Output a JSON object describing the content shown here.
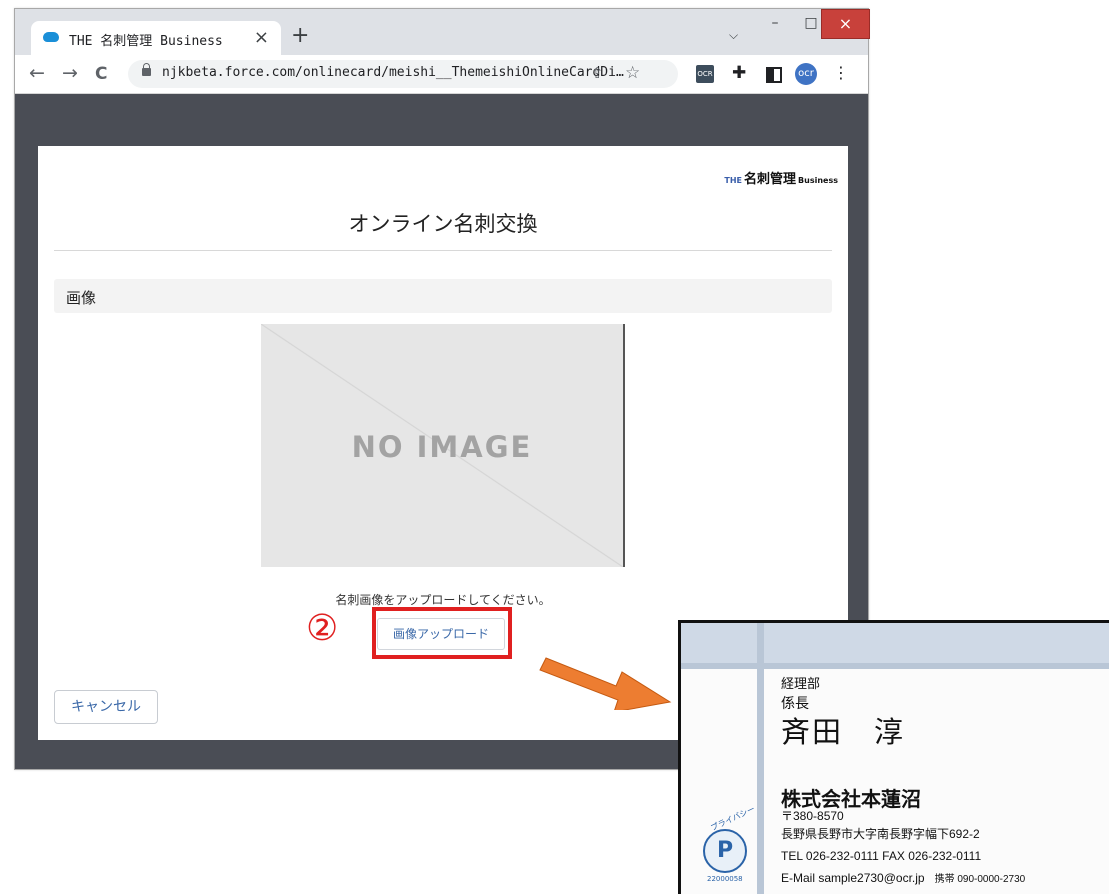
{
  "browser": {
    "tab_title": "THE 名刺管理 Business",
    "tab_close": "×",
    "new_tab": "+",
    "tab_search": "⌵",
    "window_min": "–",
    "window_max": "□",
    "window_close": "×",
    "back": "←",
    "forward": "→",
    "reload": "C",
    "url": "njkbeta.force.com/onlinecard/meishi__ThemeishiOnlineCardDi…",
    "share_icon": "⇪",
    "star_icon": "☆",
    "ext_ocr": "OCR",
    "puzzle_icon": "✚",
    "profile": "ocr",
    "menu_icon": "⋮"
  },
  "page": {
    "brand": {
      "prefix": "THE",
      "main": "名刺管理",
      "suffix": "Business"
    },
    "title": "オンライン名刺交換",
    "section_label": "画像",
    "no_image_label": "NO IMAGE",
    "instruction": "名刺画像をアップロードしてください。",
    "upload_button": "画像アップロード",
    "cancel_button": "キャンセル"
  },
  "annotation": {
    "step_number": "②",
    "highlight_color": "#e02020",
    "arrow_color": "#ed7d31"
  },
  "business_card": {
    "department": "経理部",
    "position": "係長",
    "name": "斉田　淳",
    "company": "株式会社本蓮沼",
    "postal": "〒380-8570",
    "address": "長野県長野市大字南長野字幅下692-2",
    "phone": "TEL 026-232-0111 FAX 026-232-0111",
    "email": "E-Mail sample2730@ocr.jp",
    "mobile": "携帯 090-0000-2730",
    "privacy_mark_text": "プライバシー",
    "privacy_mark_number": "22000058"
  }
}
